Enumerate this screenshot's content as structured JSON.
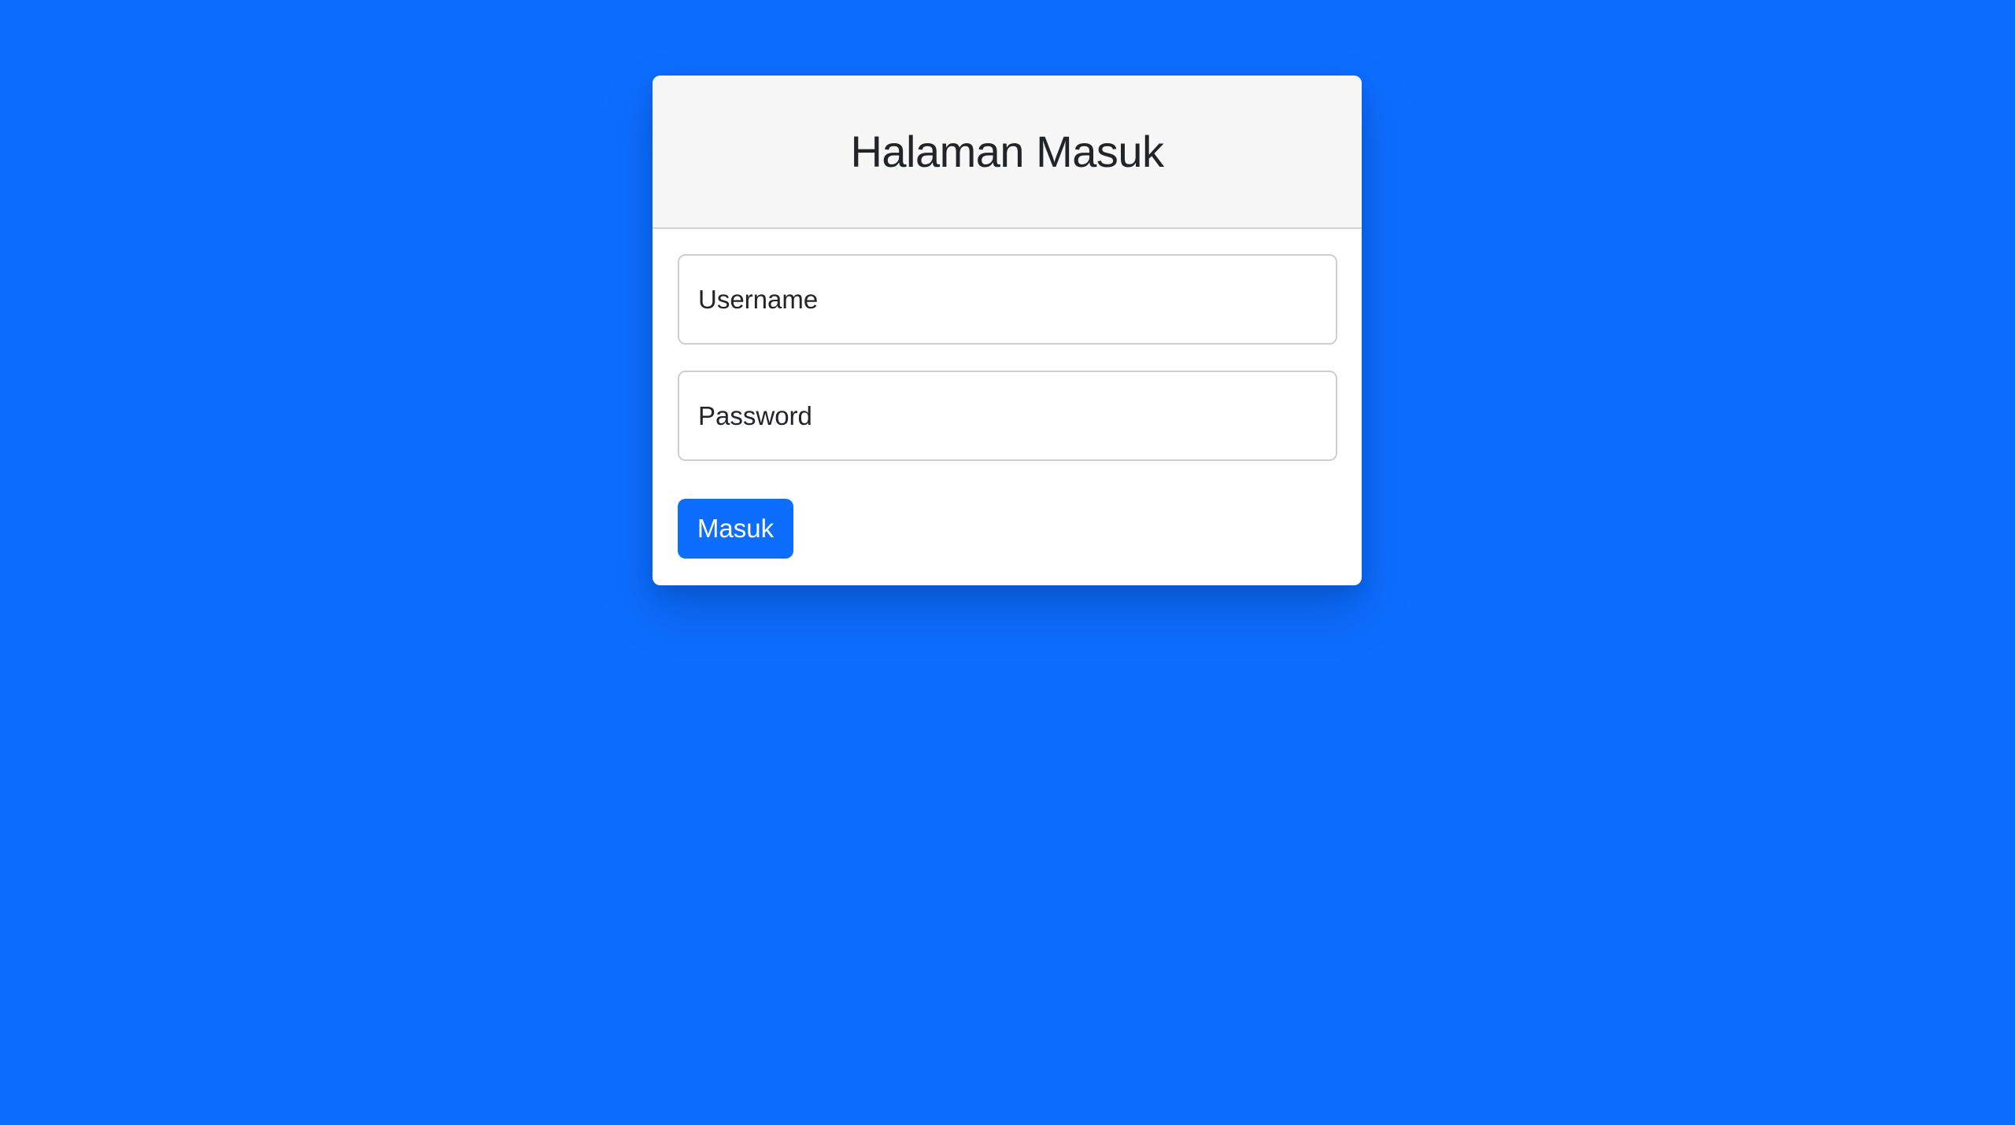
{
  "login": {
    "title": "Halaman Masuk",
    "username_placeholder": "Username",
    "password_placeholder": "Password",
    "submit_label": "Masuk"
  },
  "colors": {
    "background": "#0d6efd",
    "button": "#0d6efd",
    "header_background": "#f7f7f7"
  }
}
